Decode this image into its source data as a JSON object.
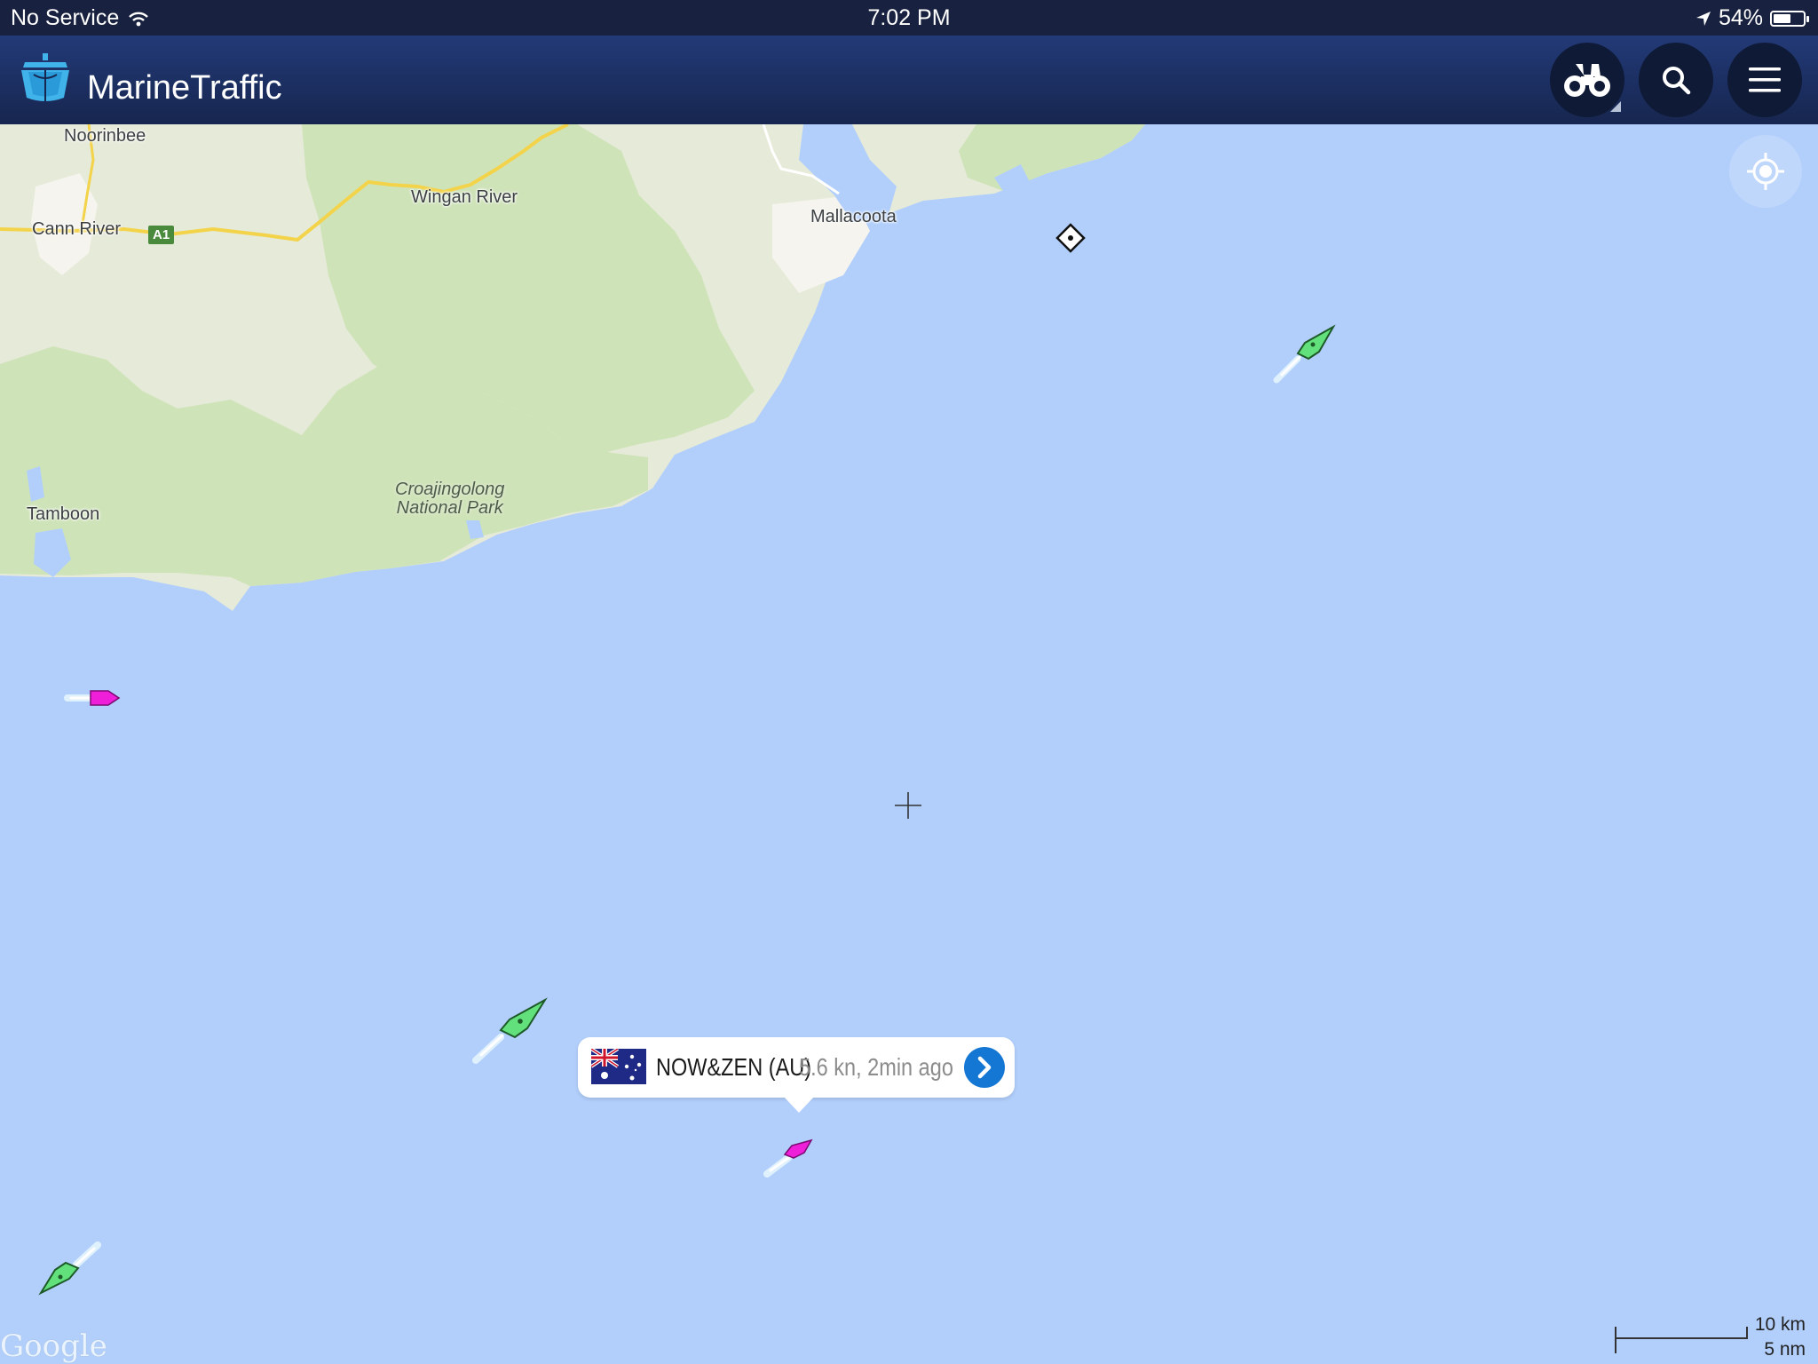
{
  "status_bar": {
    "carrier": "No Service",
    "time": "7:02 PM",
    "battery": "54%",
    "battery_level": 0.54
  },
  "header": {
    "app_name": "MarineTraffic"
  },
  "map": {
    "places": {
      "noorinbee": "Noorinbee",
      "cann_river": "Cann River",
      "wingan_river": "Wingan River",
      "mallacoota": "Mallacoota",
      "tamboon": "Tamboon",
      "park_line1": "Croajingolong",
      "park_line2": "National Park"
    },
    "road_shield": "A1",
    "attribution": "Google",
    "scale": {
      "km": "10 km",
      "nm": "5 nm"
    },
    "colors": {
      "water": "#b2cffc",
      "land": "#e6ead8",
      "forest": "#cfe3b9",
      "cargo_vessel": "#62e07c",
      "pleasure_vessel": "#ee1ed9"
    }
  },
  "callout": {
    "flag": "australia-flag-icon",
    "vessel_name": "NOW&ZEN (AU)",
    "info": "5.6 kn, 2min ago"
  }
}
